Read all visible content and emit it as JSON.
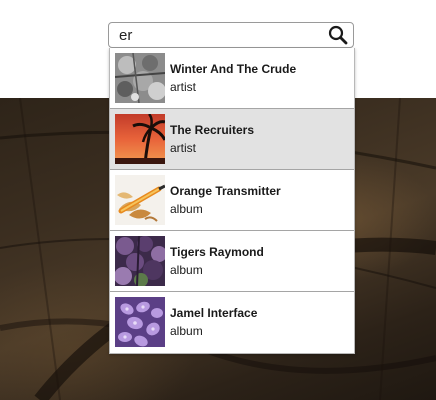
{
  "search": {
    "value": "er"
  },
  "results": [
    {
      "title": "Winter And The Crude",
      "type": "artist",
      "thumbnail": "winter-street-photo"
    },
    {
      "title": "The Recruiters",
      "type": "artist",
      "thumbnail": "palm-sunset-photo",
      "highlighted": true
    },
    {
      "title": "Orange Transmitter",
      "type": "album",
      "thumbnail": "pencil-shavings-photo"
    },
    {
      "title": "Tigers Raymond",
      "type": "album",
      "thumbnail": "purple-foliage-photo"
    },
    {
      "title": "Jamel Interface",
      "type": "album",
      "thumbnail": "purple-hydrangea-photo"
    }
  ],
  "colors": {
    "highlight": "#e2e2e2",
    "divider": "#a5a5a5",
    "backdrop": "#3b2e20"
  }
}
